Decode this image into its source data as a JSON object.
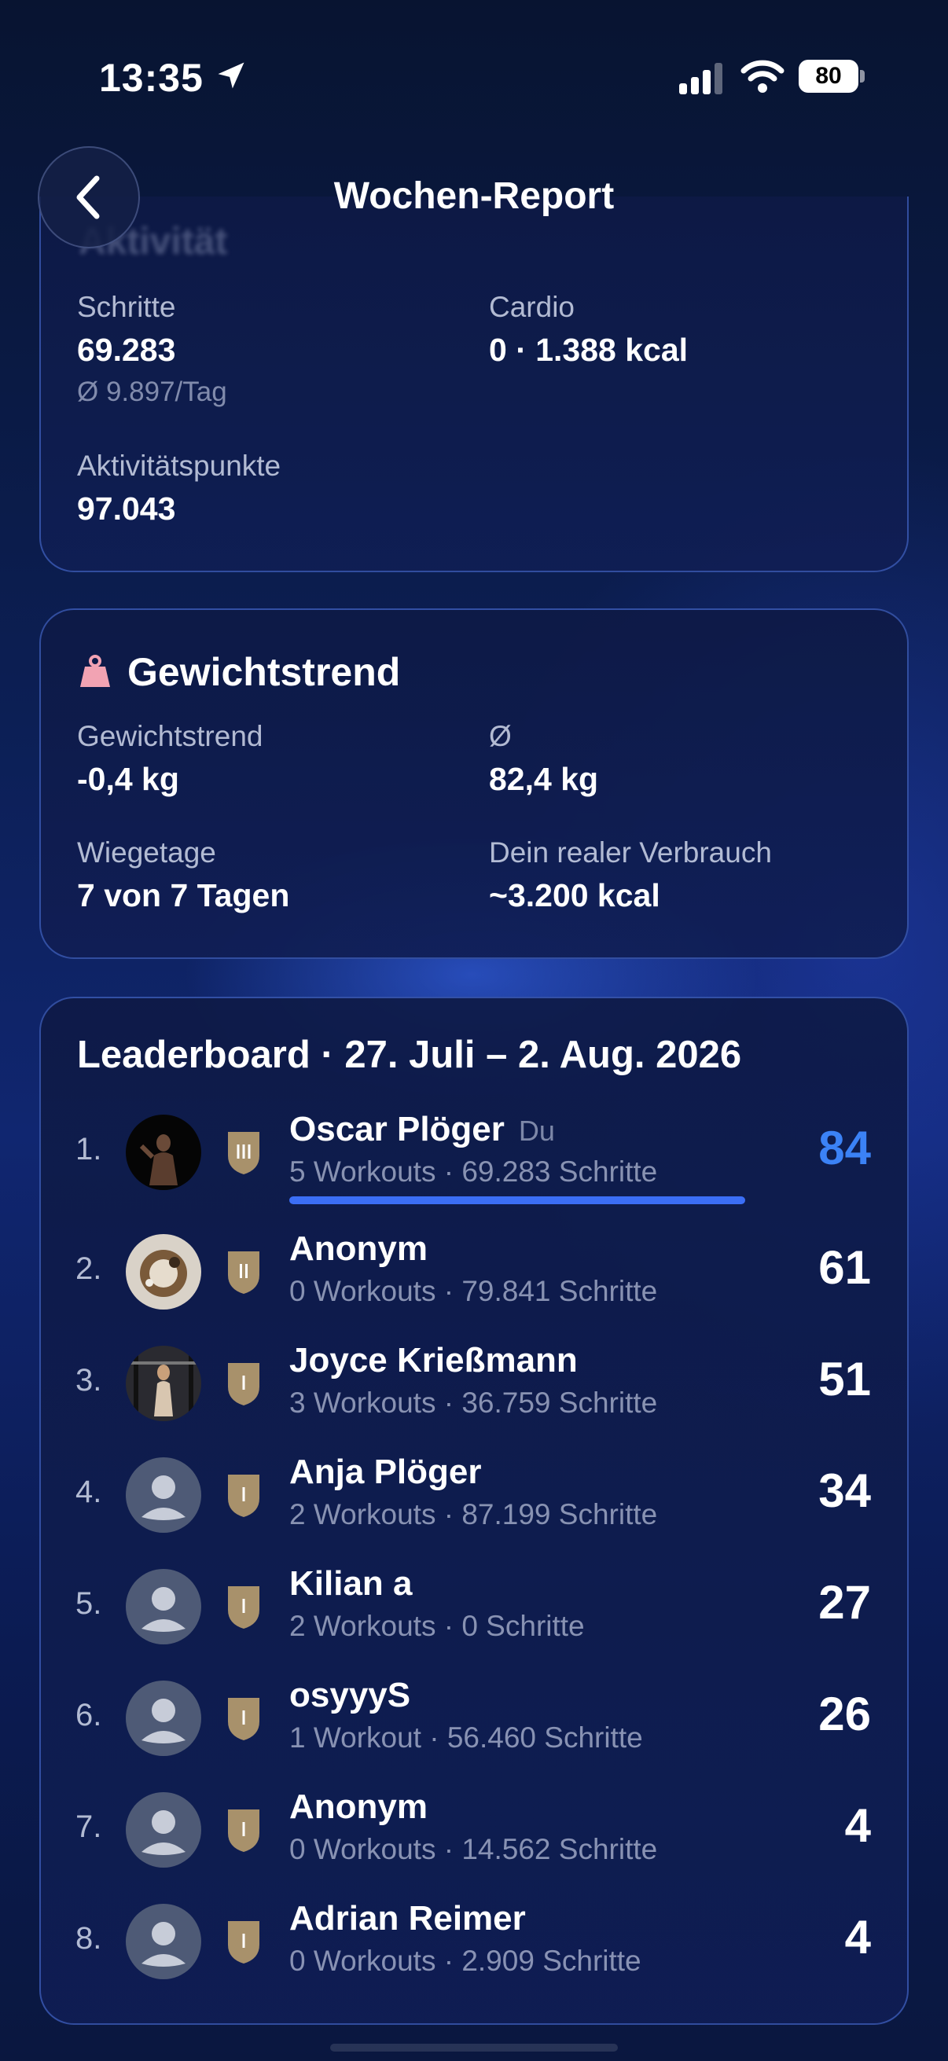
{
  "status_bar": {
    "time": "13:35",
    "battery": "80"
  },
  "header": {
    "title": "Wochen-Report"
  },
  "activity": {
    "heading": "Aktivität",
    "steps": {
      "label": "Schritte",
      "value": "69.283",
      "sub": "Ø 9.897/Tag"
    },
    "cardio": {
      "label": "Cardio",
      "value": "0 · 1.388 kcal"
    },
    "points": {
      "label": "Aktivitätspunkte",
      "value": "97.043"
    }
  },
  "weight": {
    "heading": "Gewichtstrend",
    "trend": {
      "label": "Gewichtstrend",
      "value": "-0,4 kg"
    },
    "avg": {
      "label": "Ø",
      "value": "82,4 kg"
    },
    "days": {
      "label": "Wiegetage",
      "value": "7 von 7 Tagen"
    },
    "burn": {
      "label": "Dein realer Verbrauch",
      "value": "~3.200 kcal"
    }
  },
  "leaderboard": {
    "title": "Leaderboard · 27. Juli – 2. Aug. 2026",
    "you_label": "Du",
    "rows": [
      {
        "rank": "1.",
        "name": "Oscar Plöger",
        "sub": "5 Workouts · 69.283 Schritte",
        "score": "84",
        "badge": "III",
        "avatar": "photo-dark"
      },
      {
        "rank": "2.",
        "name": "Anonym",
        "sub": "0 Workouts · 79.841 Schritte",
        "score": "61",
        "badge": "II",
        "avatar": "photo-food"
      },
      {
        "rank": "3.",
        "name": "Joyce Krießmann",
        "sub": "3 Workouts · 36.759 Schritte",
        "score": "51",
        "badge": "I",
        "avatar": "photo-gym"
      },
      {
        "rank": "4.",
        "name": "Anja Plöger",
        "sub": "2 Workouts · 87.199 Schritte",
        "score": "34",
        "badge": "I",
        "avatar": "generic"
      },
      {
        "rank": "5.",
        "name": "Kilian a",
        "sub": "2 Workouts · 0 Schritte",
        "score": "27",
        "badge": "I",
        "avatar": "generic"
      },
      {
        "rank": "6.",
        "name": "osyyyS",
        "sub": "1 Workout · 56.460 Schritte",
        "score": "26",
        "badge": "I",
        "avatar": "generic"
      },
      {
        "rank": "7.",
        "name": "Anonym",
        "sub": "0 Workouts · 14.562 Schritte",
        "score": "4",
        "badge": "I",
        "avatar": "generic"
      },
      {
        "rank": "8.",
        "name": "Adrian Reimer",
        "sub": "0 Workouts · 2.909 Schritte",
        "score": "4",
        "badge": "I",
        "avatar": "generic"
      }
    ]
  },
  "colors": {
    "accent": "#3b82f6",
    "badge": "#a8916b",
    "card_border": "#4a72e0"
  }
}
